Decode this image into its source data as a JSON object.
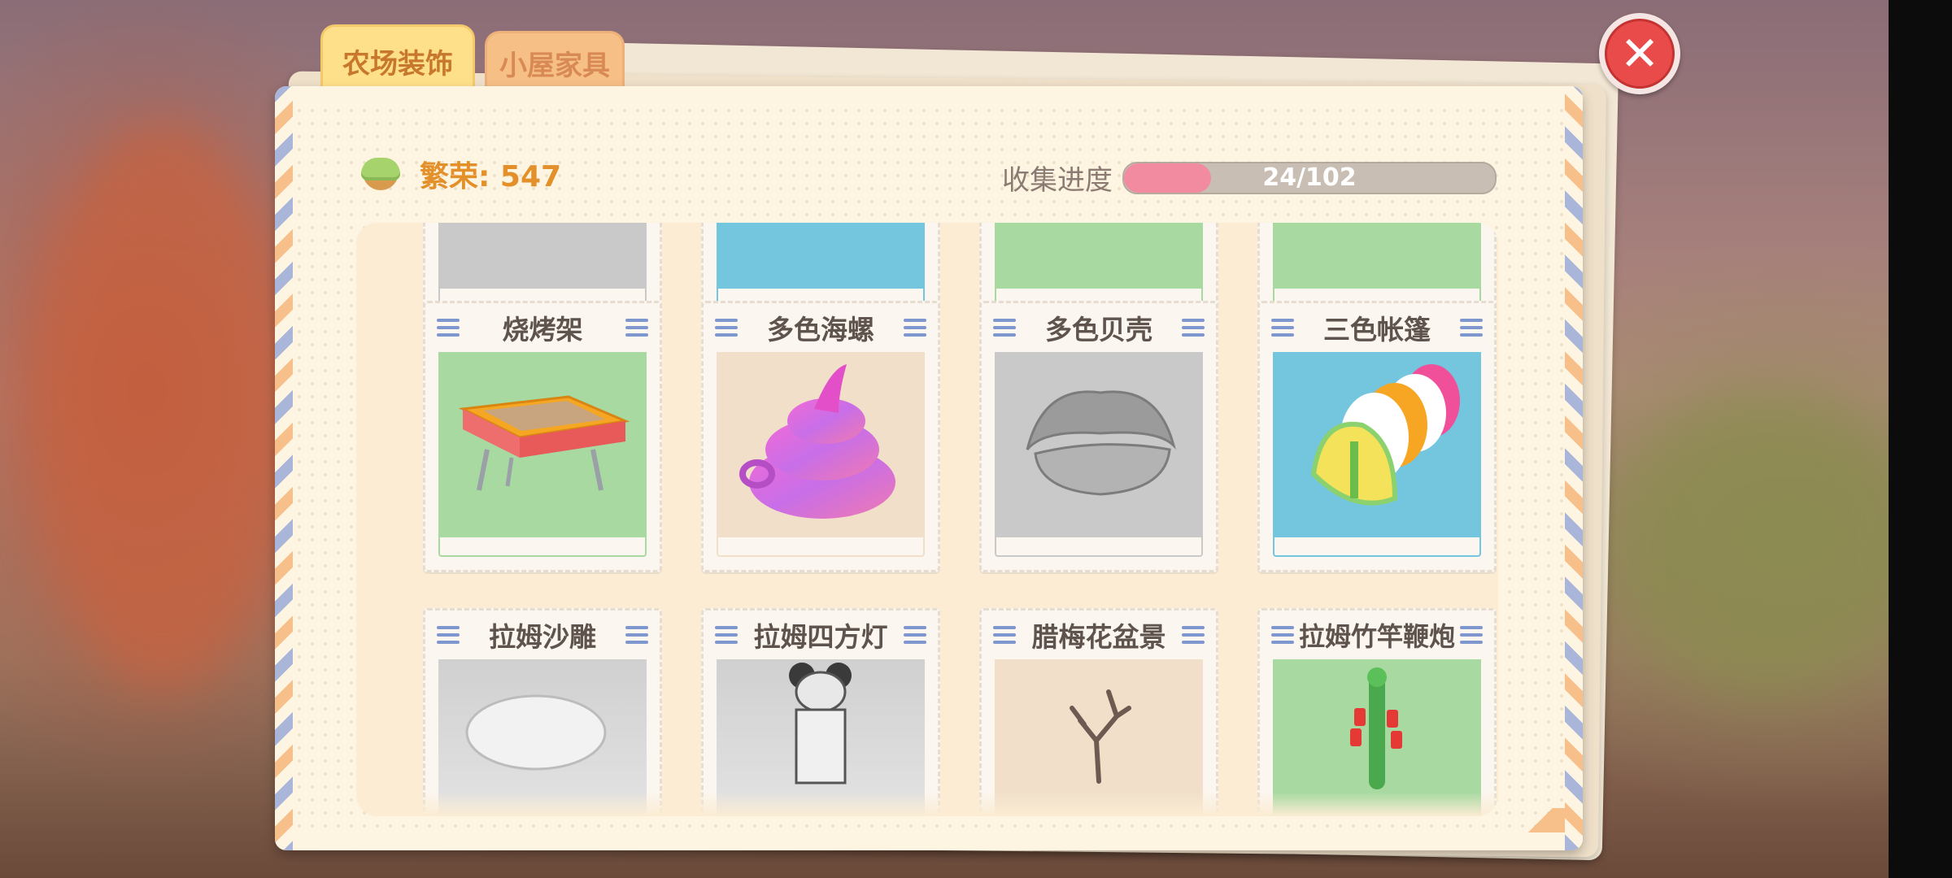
{
  "tabs": [
    {
      "label": "农场装饰",
      "active": true
    },
    {
      "label": "小屋家具",
      "active": false
    }
  ],
  "header": {
    "prosperity_label": "繁荣: 547",
    "collection_label": "收集进度",
    "progress_text": "24/102",
    "progress_fraction": 0.235
  },
  "items_row_partial": [
    {
      "bg": "gray"
    },
    {
      "bg": "blue"
    },
    {
      "bg": "green"
    },
    {
      "bg": "green"
    }
  ],
  "items_row1": [
    {
      "name": "烧烤架",
      "bg": "green"
    },
    {
      "name": "多色海螺",
      "bg": "peach"
    },
    {
      "name": "多色贝壳",
      "bg": "gray"
    },
    {
      "name": "三色帐篷",
      "bg": "blue"
    }
  ],
  "items_row2": [
    {
      "name": "拉姆沙雕",
      "bg": "gray"
    },
    {
      "name": "拉姆四方灯",
      "bg": "gray"
    },
    {
      "name": "腊梅花盆景",
      "bg": "peach"
    },
    {
      "name": "拉姆竹竿鞭炮",
      "bg": "green"
    }
  ],
  "colors": {
    "accent_orange": "#e38f2a",
    "progress_pink": "#f28aa0",
    "close_red": "#e94b4b"
  },
  "close_symbol": "✕"
}
